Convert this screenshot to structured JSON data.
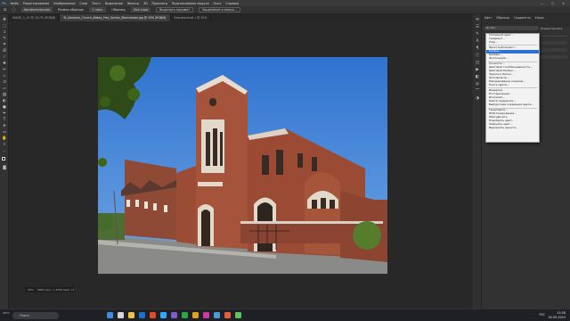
{
  "menubar": {
    "items": [
      "Файл",
      "Редактирование",
      "Изображение",
      "Слои",
      "Текст",
      "Выделение",
      "Фильтр",
      "3D",
      "Просмотр",
      "Подключаемые модули",
      "Окно",
      "Справка"
    ],
    "window_controls": [
      "—",
      "▢",
      "✕"
    ]
  },
  "options_bar": {
    "home_icon": "home-icon",
    "tool_preset": "Автоматическая",
    "sample_label": "Размер образца:",
    "sample_value": "1 пикс.",
    "layers_label": "Образец:",
    "layers_value": "Все слои",
    "select_subject": "Выделить предмет",
    "select_mask": "Выделение и маска..."
  },
  "document_tabs": [
    {
      "label": "IMAGE_1_14 @ 16,7% (RGB/8)",
      "active": false
    },
    {
      "label": "St_Saviours_Church_Abbey_Hey_Gorton_Manchester.jpg @ 15% (RGB/8)",
      "active": true
    },
    {
      "label": "Безымянный-1 @ 50%",
      "active": false
    }
  ],
  "status": {
    "zoom": "15%",
    "doc_info": "3000 пикс. x 2250 пикс. (72 ppi)"
  },
  "right_panel": {
    "tabs": [
      "Цвет",
      "Образцы",
      "Градиенты",
      "Узоры"
    ],
    "search_placeholder": "По бос",
    "row_label": "Корректировка"
  },
  "dropdown": {
    "groups": [
      [
        "Сплошной цвет...",
        "Градиент...",
        "Узор..."
      ],
      [
        "Яркость/Контраст...",
        "Уровни...",
        "Кривые...",
        "Экспозиция..."
      ],
      [
        "Сочность...",
        "Цветовой тон/Насыщенность...",
        "Цветовой баланс...",
        "Черное и белое...",
        "Фотофильтр...",
        "Микширование каналов...",
        "Поиск цвета..."
      ],
      [
        "Инверсия",
        "Постеризация...",
        "Изогелия...",
        "Карта градиента...",
        "Выборочная коррекция цвета..."
      ],
      [
        "Тени/Света...",
        "HDR-тонирование...",
        "Обесцветить",
        "Подобрать цвет...",
        "Заменить цвет...",
        "Выровнять яркость"
      ]
    ],
    "selected": "Уровни..."
  },
  "taskbar": {
    "weather_temp": "15°C",
    "weather_text": "Солнечно",
    "search_placeholder": "Поиск",
    "tray": "РУС",
    "time": "13:58",
    "date": "02.05.2024"
  }
}
